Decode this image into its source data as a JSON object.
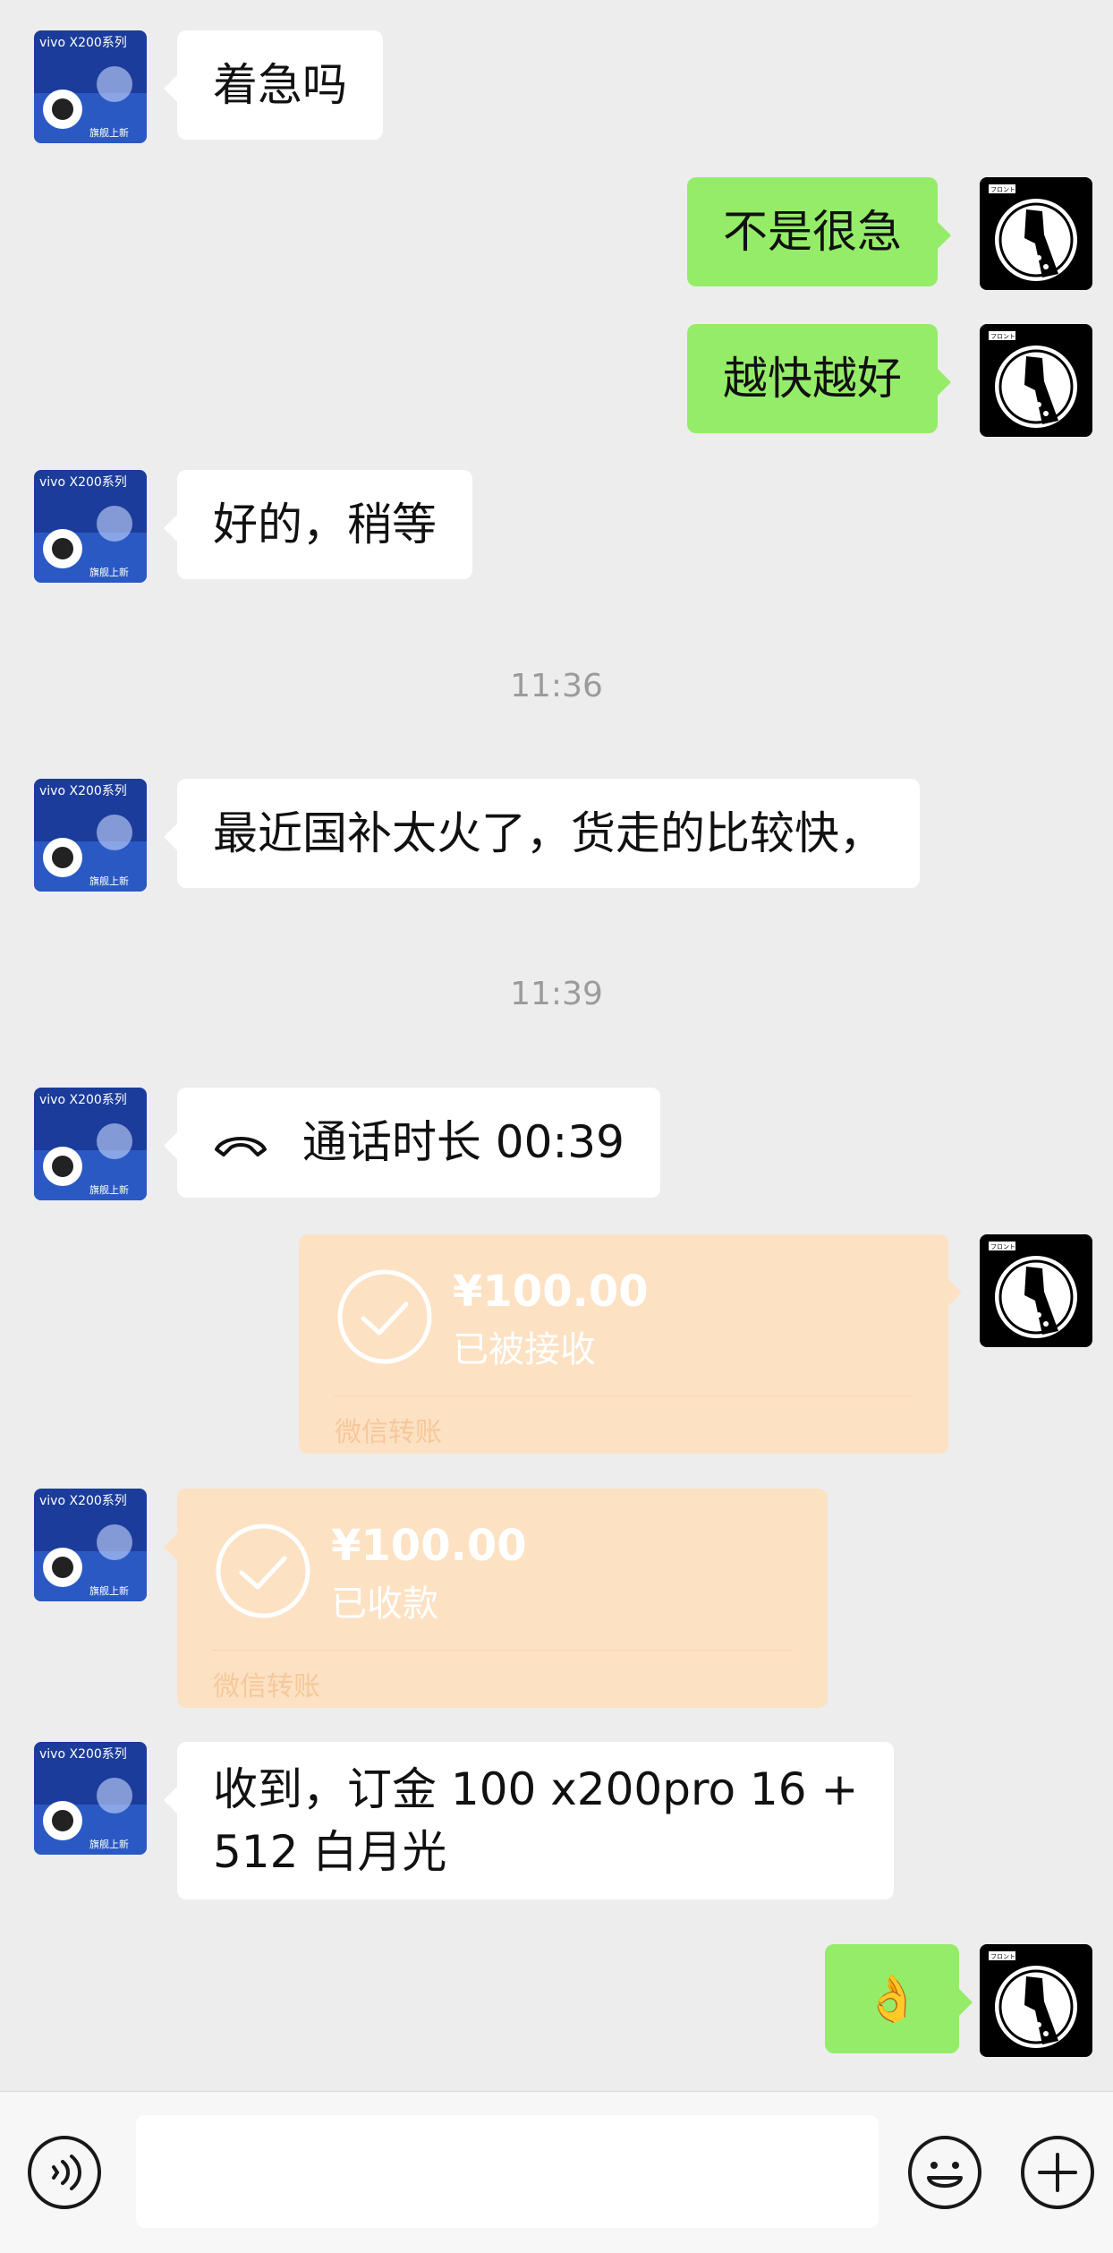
{
  "messages": {
    "m1": "着急吗",
    "m2": "不是很急",
    "m3": "越快越好",
    "m4": "好的，稍等",
    "t1": "11:36",
    "m5": "最近国补太火了，货走的比较快，",
    "t2": "11:39",
    "call": "通话时长 00:39",
    "transfer_sent": {
      "amount": "¥100.00",
      "status": "已被接收",
      "label": "微信转账"
    },
    "transfer_received": {
      "amount": "¥100.00",
      "status": "已收款",
      "label": "微信转账"
    },
    "m6_line1": "收到，订金 100 x200pro 16  +",
    "m6_line2": "512 白月光",
    "m7": "👌"
  },
  "avatars": {
    "contact_brand_text": "vivo X200系列",
    "contact_tag_text": "旗舰上新",
    "me_tag_text": "フロント"
  },
  "input": {
    "placeholder": ""
  },
  "icons": {
    "voice": "voice-icon",
    "emoji": "emoji-icon",
    "plus": "plus-icon",
    "call": "phone-hangup-icon",
    "transfer": "check-circle-icon"
  },
  "colors": {
    "background": "#ededed",
    "sent_bubble": "#95ec69",
    "received_bubble": "#ffffff",
    "transfer_bubble": "#fde1c3"
  }
}
